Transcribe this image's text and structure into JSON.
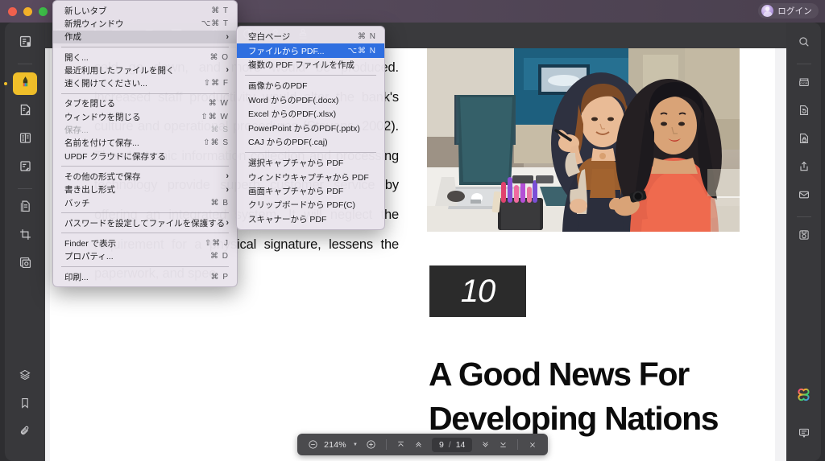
{
  "titlebar": {
    "login_label": "ログイン",
    "avatar_name": "user-avatar"
  },
  "left_rail": {
    "items": [
      {
        "name": "page-thumbnails",
        "icon": "document-thumbnail-icon",
        "active": false
      },
      {
        "name": "annotate-tool",
        "icon": "highlighter-pen-icon",
        "active": true
      },
      {
        "name": "edit-pdf-tool",
        "icon": "edit-document-icon",
        "active": false
      },
      {
        "name": "organize-pages-tool",
        "icon": "page-list-icon",
        "active": false
      },
      {
        "name": "form-tool",
        "icon": "form-edit-icon",
        "active": false
      },
      {
        "name": "page-edit-tool",
        "icon": "document-pages-icon",
        "active": false
      },
      {
        "name": "crop-tool",
        "icon": "crop-icon",
        "active": false
      },
      {
        "name": "background-tool",
        "icon": "watermark-icon",
        "active": false
      }
    ],
    "bottom_items": [
      {
        "name": "layers-panel",
        "icon": "layers-icon"
      },
      {
        "name": "bookmarks-panel",
        "icon": "bookmark-icon"
      },
      {
        "name": "attachments-panel",
        "icon": "paperclip-icon"
      }
    ]
  },
  "right_rail": {
    "items": [
      {
        "name": "search",
        "icon": "search-icon"
      },
      {
        "name": "ocr",
        "icon": "ocr-icon"
      },
      {
        "name": "convert",
        "icon": "convert-document-icon"
      },
      {
        "name": "protect",
        "icon": "lock-document-icon"
      },
      {
        "name": "share",
        "icon": "share-upload-icon"
      },
      {
        "name": "email",
        "icon": "mail-icon"
      },
      {
        "name": "save-cloud",
        "icon": "save-disk-icon"
      }
    ],
    "bottom_items": [
      {
        "name": "ai-assistant",
        "icon": "ai-sparkle-icon"
      },
      {
        "name": "comments",
        "icon": "comment-icon"
      }
    ]
  },
  "toolbar": {
    "items": [
      {
        "name": "text-comment-tool",
        "icon": "text-note-icon",
        "caret": false
      },
      {
        "name": "pen-tool",
        "icon": "pen-icon",
        "caret": false
      },
      {
        "name": "highlight-tool",
        "icon": "highlighter-icon",
        "caret": false
      },
      {
        "name": "shape-tool",
        "icon": "square-shape-icon",
        "caret": true
      },
      {
        "name": "measure-tool",
        "icon": "arrow-shape-icon",
        "caret": true
      },
      {
        "name": "attach-tool",
        "icon": "paperclip-icon",
        "caret": false
      },
      {
        "name": "stamp-tool",
        "icon": "stamp-circle-icon",
        "caret": false
      },
      {
        "name": "signature-tool",
        "icon": "person-sign-icon",
        "caret": false
      },
      {
        "name": "seal-tool",
        "icon": "seal-stamp-icon",
        "caret": false
      }
    ]
  },
  "zoombar": {
    "zoom_out_icon": "minus-circle-icon",
    "zoom_level": "214%",
    "zoom_in_icon": "plus-circle-icon",
    "first_page_icon": "first-page-icon",
    "prev_page_icon": "prev-page-icon",
    "current_page": "9",
    "separator": "/",
    "total_pages": "14",
    "next_page_icon": "next-page-icon",
    "last_page_icon": "last-page-icon",
    "close_icon": "close-icon"
  },
  "file_menu": {
    "items": [
      {
        "label": "新しいタブ",
        "shortcut": "⌘ T",
        "arrow": false,
        "state": "normal",
        "sep_after": false
      },
      {
        "label": "新規ウィンドウ",
        "shortcut": "⌥⌘ T",
        "arrow": false,
        "state": "normal",
        "sep_after": false
      },
      {
        "label": "作成",
        "shortcut": "",
        "arrow": true,
        "state": "sel-gray",
        "sep_after": true
      },
      {
        "label": "開く...",
        "shortcut": "⌘ O",
        "arrow": false,
        "state": "normal",
        "sep_after": false
      },
      {
        "label": "最近利用したファイルを開く",
        "shortcut": "",
        "arrow": true,
        "state": "normal",
        "sep_after": false
      },
      {
        "label": "速く開けてください...",
        "shortcut": "⇧⌘ F",
        "arrow": false,
        "state": "normal",
        "sep_after": true
      },
      {
        "label": "タブを閉じる",
        "shortcut": "⌘ W",
        "arrow": false,
        "state": "normal",
        "sep_after": false
      },
      {
        "label": "ウィンドウを閉じる",
        "shortcut": "⇧⌘ W",
        "arrow": false,
        "state": "normal",
        "sep_after": false
      },
      {
        "label": "保存...",
        "shortcut": "⌘ S",
        "arrow": false,
        "state": "disabled",
        "sep_after": false
      },
      {
        "label": "名前を付けて保存...",
        "shortcut": "⇧⌘ S",
        "arrow": false,
        "state": "normal",
        "sep_after": false
      },
      {
        "label": "UPDF クラウドに保存する",
        "shortcut": "",
        "arrow": false,
        "state": "normal",
        "sep_after": true
      },
      {
        "label": "その他の形式で保存",
        "shortcut": "",
        "arrow": true,
        "state": "normal",
        "sep_after": false
      },
      {
        "label": "書き出し形式",
        "shortcut": "",
        "arrow": true,
        "state": "normal",
        "sep_after": false
      },
      {
        "label": "バッチ",
        "shortcut": "⌘ B",
        "arrow": false,
        "state": "normal",
        "sep_after": true
      },
      {
        "label": "パスワードを設定してファイルを保護する",
        "shortcut": "",
        "arrow": true,
        "state": "normal",
        "sep_after": true
      },
      {
        "label": "Finder で表示",
        "shortcut": "⇧⌘ J",
        "arrow": false,
        "state": "normal",
        "sep_after": false
      },
      {
        "label": "プロパティ...",
        "shortcut": "⌘ D",
        "arrow": false,
        "state": "normal",
        "sep_after": true
      },
      {
        "label": "印刷...",
        "shortcut": "⌘ P",
        "arrow": false,
        "state": "normal",
        "sep_after": false
      }
    ]
  },
  "create_submenu": {
    "items": [
      {
        "label": "空白ページ",
        "shortcut": "⌘ N",
        "state": "normal",
        "sep_after": false
      },
      {
        "label": "ファイルから PDF...",
        "shortcut": "⌥⌘ N",
        "state": "sel-blue",
        "sep_after": false
      },
      {
        "label": "複数の PDF ファイルを作成",
        "shortcut": "",
        "state": "normal",
        "sep_after": true
      },
      {
        "label": "画像からのPDF",
        "shortcut": "",
        "state": "normal",
        "sep_after": false
      },
      {
        "label": "Word からのPDF(.docx)",
        "shortcut": "",
        "state": "normal",
        "sep_after": false
      },
      {
        "label": "Excel からのPDF(.xlsx)",
        "shortcut": "",
        "state": "normal",
        "sep_after": false
      },
      {
        "label": "PowerPoint からのPDF(.pptx)",
        "shortcut": "",
        "state": "normal",
        "sep_after": false
      },
      {
        "label": "CAJ からのPDF(.caj)",
        "shortcut": "",
        "state": "normal",
        "sep_after": true
      },
      {
        "label": "選択キャプチャから PDF",
        "shortcut": "",
        "state": "normal",
        "sep_after": false
      },
      {
        "label": "ウィンドウキャプチャから PDF",
        "shortcut": "",
        "state": "normal",
        "sep_after": false
      },
      {
        "label": "画面キャプチャから PDF",
        "shortcut": "",
        "state": "normal",
        "sep_after": false
      },
      {
        "label": "クリップボードから PDF(C)",
        "shortcut": "",
        "state": "normal",
        "sep_after": false
      },
      {
        "label": "スキャナーから PDF",
        "shortcut": "",
        "state": "normal",
        "sep_after": false
      }
    ]
  },
  "document": {
    "body_text": "sald go down, and more would be produced. increased staff productivity would alter the bank's culture and operational procedures (Stevens, 2002). The electronic information collection and processing technology provide superb customer service by offering an integrated system. It will neglect the requirement for a physical signature, lessens the paperwork, and spee",
    "chapter_number": "10",
    "headline": "A Good News For Developing Nations",
    "photo_alt": "two-women-at-desk-with-laptop-in-office"
  }
}
